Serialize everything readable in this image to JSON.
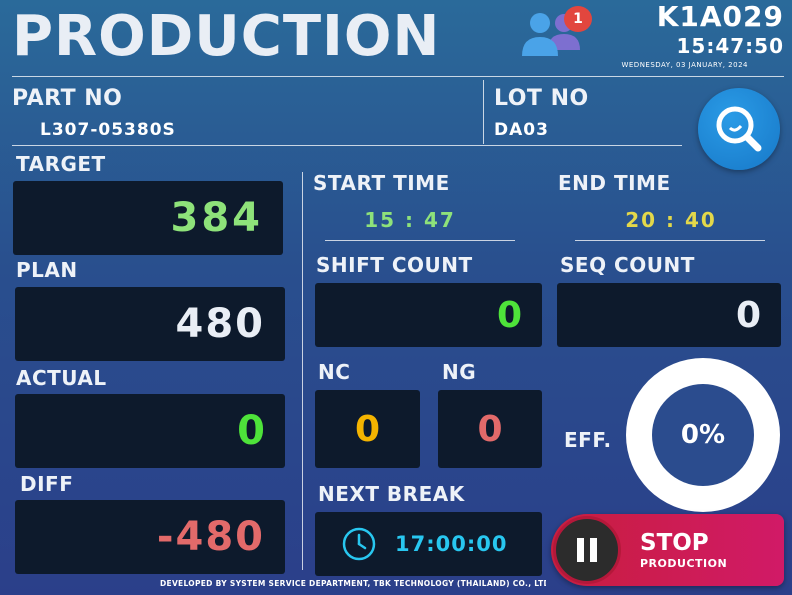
{
  "header": {
    "title": "PRODUCTION",
    "notification_count": "1",
    "machine_id": "K1A029",
    "clock": "15:47:50",
    "date": "WEDNESDAY, 03 JANUARY, 2024"
  },
  "part": {
    "label": "PART NO",
    "value": "L307-05380S"
  },
  "lot": {
    "label": "LOT NO",
    "value": "DA03"
  },
  "target": {
    "label": "TARGET",
    "value": "384",
    "color": "#8ee27a"
  },
  "plan": {
    "label": "PLAN",
    "value": "480",
    "color": "#e9eef5"
  },
  "actual": {
    "label": "ACTUAL",
    "value": "0",
    "color": "#4ee33a"
  },
  "diff": {
    "label": "DIFF",
    "value": "-480",
    "color": "#e26a6a"
  },
  "start_time": {
    "label": "START TIME",
    "hour": "15",
    "sep": ":",
    "minute": "47",
    "color": "#8ee27a"
  },
  "end_time": {
    "label": "END TIME",
    "hour": "20",
    "sep": ":",
    "minute": "40",
    "color": "#e3d84a"
  },
  "shift_count": {
    "label": "SHIFT COUNT",
    "value": "0",
    "color": "#4ee33a"
  },
  "seq_count": {
    "label": "SEQ COUNT",
    "value": "0",
    "color": "#e9eef5"
  },
  "nc": {
    "label": "NC",
    "value": "0",
    "color": "#f4b400"
  },
  "ng": {
    "label": "NG",
    "value": "0",
    "color": "#e26a6a"
  },
  "efficiency": {
    "label": "EFF.",
    "value": "0%"
  },
  "next_break": {
    "label": "NEXT BREAK",
    "value": "17:00:00",
    "color": "#28c7f0",
    "icon": "clock-icon"
  },
  "stop_button": {
    "line1": "STOP",
    "line2": "PRODUCTION",
    "icon": "pause-icon"
  },
  "footer": "DEVELOPED BY SYSTEM SERVICE DEPARTMENT, TBK TECHNOLOGY (THAILAND) CO., LTD."
}
